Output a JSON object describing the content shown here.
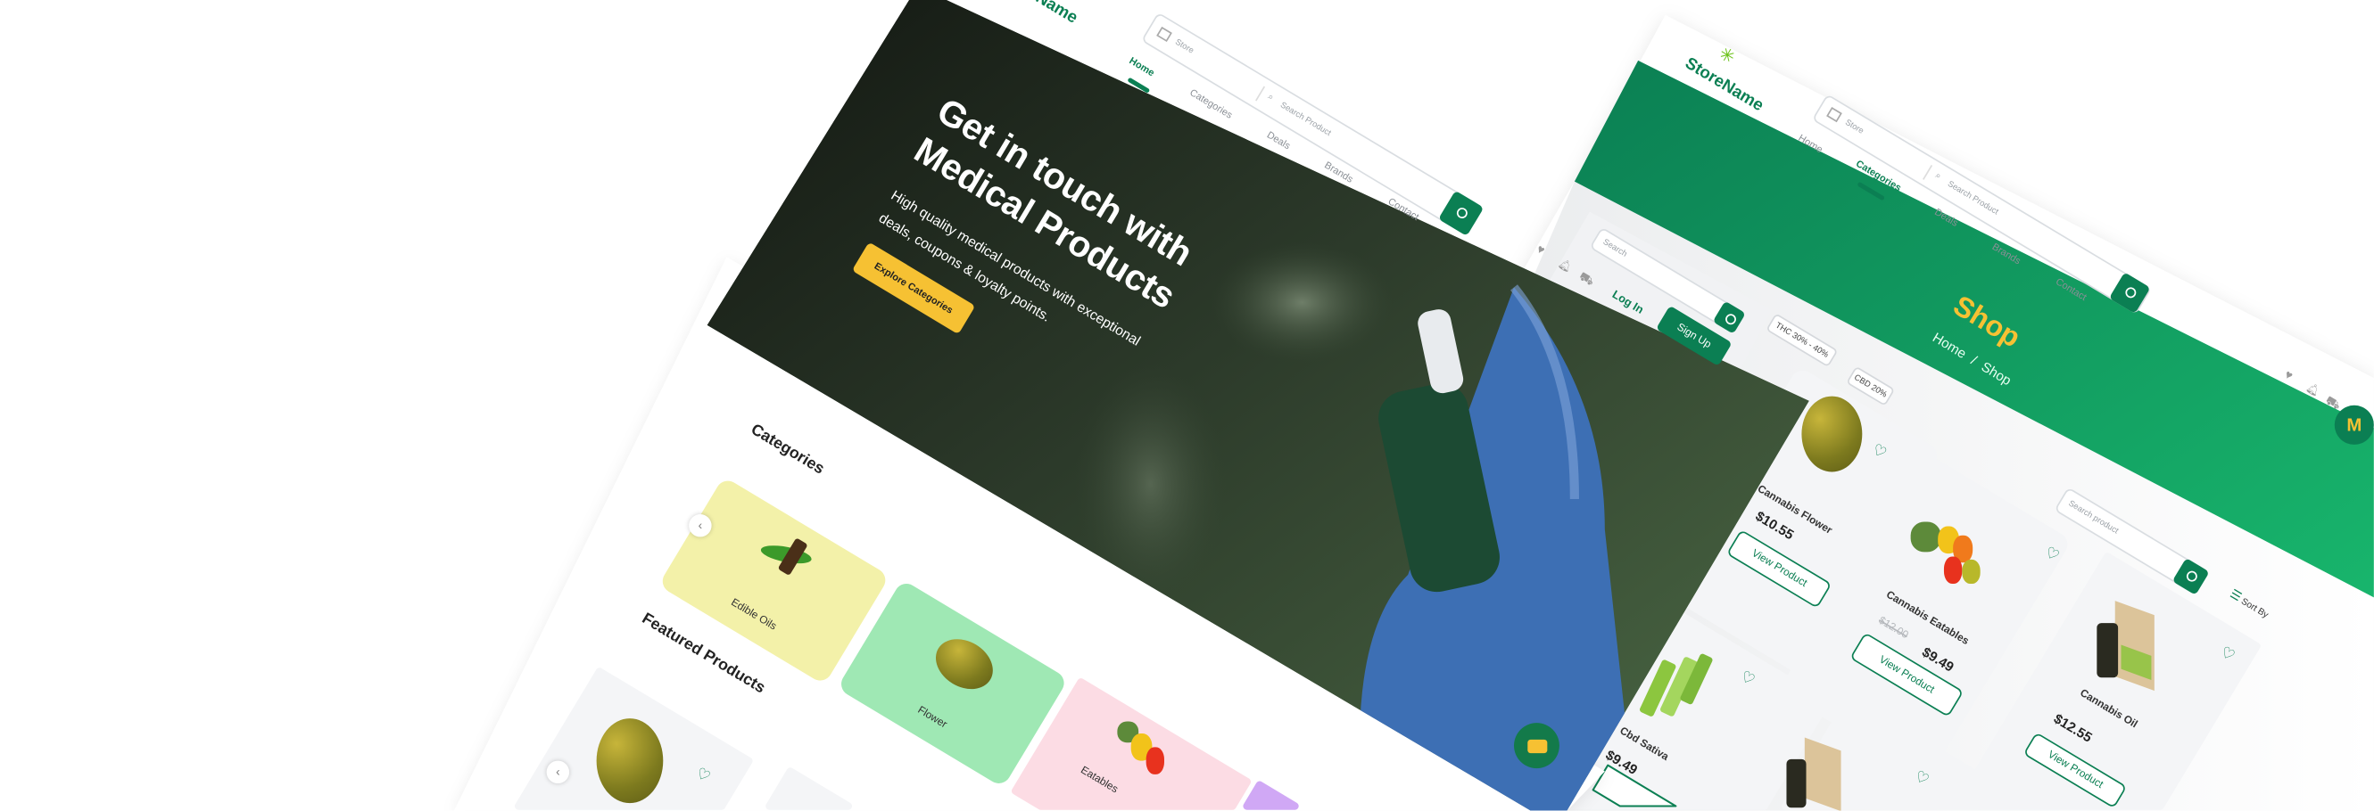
{
  "left_screen": {
    "logo": "StoreName",
    "store_select": "Store",
    "search_placeholder": "Search Product",
    "nav": [
      "Home",
      "Categories",
      "Deals",
      "Brands",
      "Contact"
    ],
    "active_nav": "Home",
    "login": "Log In",
    "signup": "Sign Up",
    "hero": {
      "title_line1": "Get in touch with",
      "title_line2": "Medical Products",
      "subtitle_line1": "High quality medical products with exceptional",
      "subtitle_line2": "deals, coupons & loyalty points.",
      "cta": "Explore Categories"
    },
    "categories_title": "Categories",
    "categories": [
      {
        "label": "Edible Oils",
        "color": "#f3f1a9"
      },
      {
        "label": "Flower",
        "color": "#9fe8b4"
      },
      {
        "label": "Eatables",
        "color": "#fcdce4"
      },
      {
        "label": "",
        "color": "#d0a8f5"
      }
    ],
    "featured_title": "Featured Products"
  },
  "right_screen": {
    "logo": "StoreName",
    "store_select": "Store",
    "search_placeholder": "Search Product",
    "nav": [
      "Home",
      "Categories",
      "Deals",
      "Brands",
      "Contact"
    ],
    "active_nav": "Categories",
    "sidebar_search": "Search",
    "chips": [
      "THC 30% - 40%",
      "CBD 20%"
    ],
    "banner": {
      "title": "Shop",
      "crumb_home": "Home",
      "crumb_sep": "/",
      "crumb_current": "Shop"
    },
    "product_search_placeholder": "Search product",
    "sort_label": "Sort By",
    "avatar_initial": "M",
    "view_label": "View Product",
    "products": [
      {
        "name": "Cannabis Flower",
        "price": "$10.55"
      },
      {
        "name": "Cannabis Eatables",
        "old_price": "$12.00",
        "price": "$9.49"
      },
      {
        "name": "Cannabis Oil",
        "price": "$12.55"
      },
      {
        "name": "Cbd Sativa",
        "price": "$9.49"
      }
    ]
  },
  "colors": {
    "brand_green": "#0b7f53",
    "accent_yellow": "#f6c133",
    "banner_light": "#16b26a"
  }
}
